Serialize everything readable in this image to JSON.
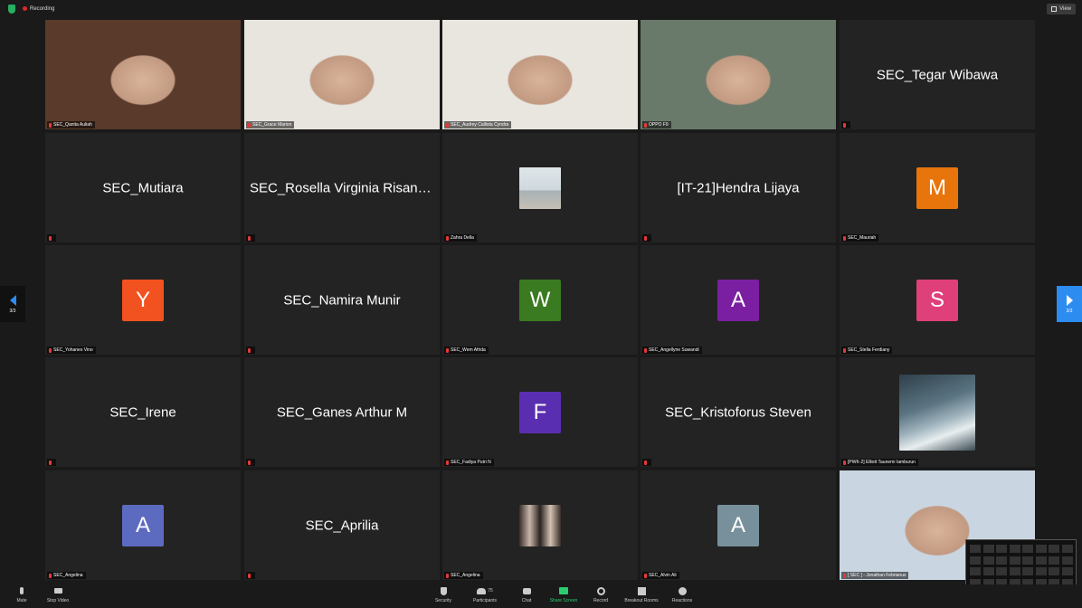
{
  "top_bar": {
    "recording_label": "Recording",
    "view_label": "View"
  },
  "tiles": [
    {
      "type": "video",
      "label": "SEC_Qanita Auliah",
      "bg": "#5a3a2a"
    },
    {
      "type": "video",
      "label": "SEC_Grace Marion",
      "bg": "#e8e4de"
    },
    {
      "type": "video",
      "label": "SEC_Audrey Callista Cyndra",
      "bg": "#e9e6e0"
    },
    {
      "type": "video",
      "label": "OPPO F9",
      "bg": "#6a7a6a"
    },
    {
      "type": "name",
      "name": "SEC_Tegar Wibawa",
      "label": ""
    },
    {
      "type": "name",
      "name": "SEC_Mutiara",
      "label": ""
    },
    {
      "type": "name",
      "name": "SEC_Rosella Virginia Risang...",
      "label": ""
    },
    {
      "type": "thumb",
      "label": "Zahra Della",
      "thumb": "beach"
    },
    {
      "type": "name",
      "name": "[IT-21]Hendra Lijaya",
      "label": ""
    },
    {
      "type": "avatar",
      "letter": "M",
      "color": "#e8740c",
      "label": "SEC_Mauriah"
    },
    {
      "type": "avatar",
      "letter": "Y",
      "color": "#f2521f",
      "label": "SEC_Yohanes Vino"
    },
    {
      "type": "name",
      "name": "SEC_Namira Munir",
      "label": ""
    },
    {
      "type": "avatar",
      "letter": "W",
      "color": "#3a7a20",
      "label": "SEC_Wem Afrida"
    },
    {
      "type": "avatar",
      "letter": "A",
      "color": "#7b1fa2",
      "label": "SEC_Angellyne Suwandi"
    },
    {
      "type": "avatar",
      "letter": "S",
      "color": "#e0407a",
      "label": "SEC_Stella Ferdiany"
    },
    {
      "type": "name",
      "name": "SEC_Irene",
      "label": ""
    },
    {
      "type": "name",
      "name": "SEC_Ganes Arthur M",
      "label": ""
    },
    {
      "type": "avatar",
      "letter": "F",
      "color": "#5a2eb0",
      "label": "SEC_Fadiya Putri N"
    },
    {
      "type": "name",
      "name": "SEC_Kristoforus Steven",
      "label": ""
    },
    {
      "type": "thumb",
      "label": "[PWK-2] Elliott Taunemi Iamburun",
      "thumb": "storm"
    },
    {
      "type": "avatar",
      "letter": "A",
      "color": "#5c6bc0",
      "label": "SEC_Angelina"
    },
    {
      "type": "name",
      "name": "SEC_Aprilia",
      "label": ""
    },
    {
      "type": "thumb",
      "label": "SEC_Angelina",
      "thumb": "photo"
    },
    {
      "type": "avatar",
      "letter": "A",
      "color": "#78909c",
      "label": "SEC_Alvin Ali"
    },
    {
      "type": "video",
      "label": "[ SEC ] - Jonathan Febrianus",
      "bg": "#c9d6e2"
    }
  ],
  "nav": {
    "left_page": "3/3",
    "right_page": "3/3"
  },
  "toolbar": {
    "mute": "Mute",
    "stop_video": "Stop Video",
    "security": "Security",
    "participants": "Participants",
    "participants_count": "75",
    "chat": "Chat",
    "share_screen": "Share Screen",
    "record": "Record",
    "breakout_rooms": "Breakout Rooms",
    "reactions": "Reactions"
  },
  "colors": {
    "accent": "#2d8cf0",
    "share": "#2ecc71",
    "muted": "#e53935"
  }
}
